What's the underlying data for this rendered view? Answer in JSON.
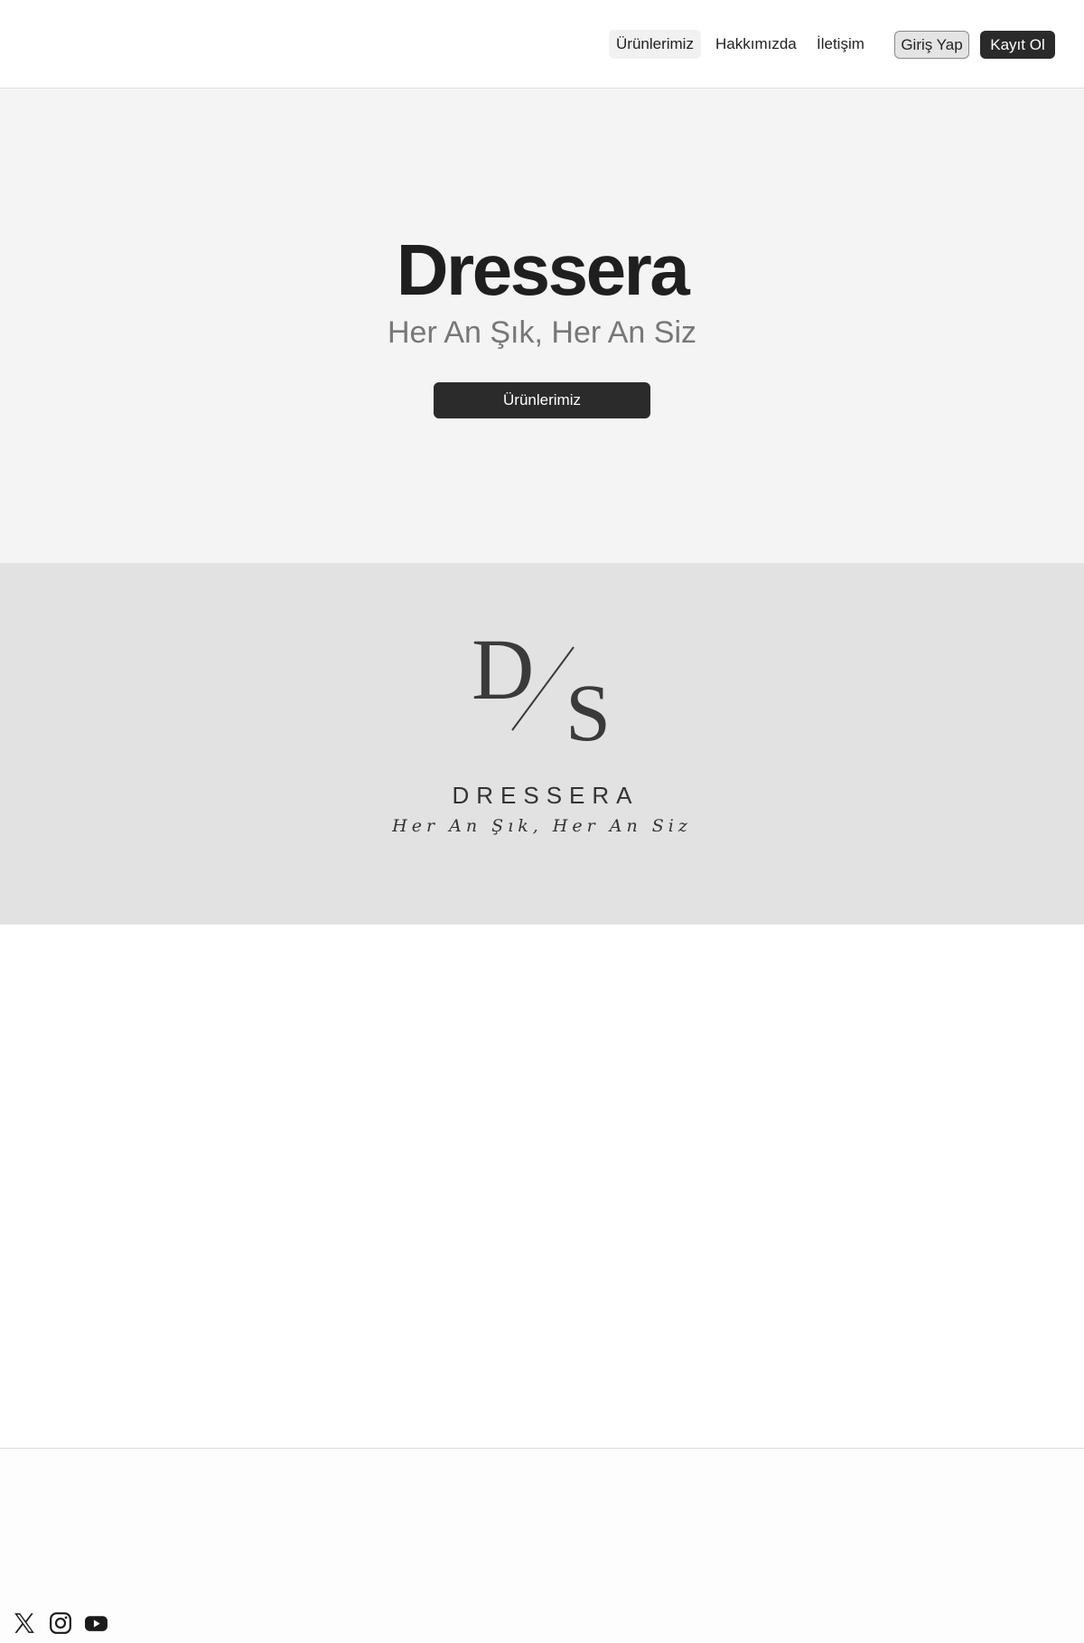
{
  "nav": {
    "links": [
      {
        "label": "Ürünlerimiz"
      },
      {
        "label": "Hakkımızda"
      },
      {
        "label": "İletişim"
      }
    ],
    "login_label": "Giriş Yap",
    "register_label": "Kayıt Ol"
  },
  "hero": {
    "title": "Dressera",
    "subtitle": "Her An Şık, Her An Siz",
    "cta_label": "Ürünlerimiz"
  },
  "brand": {
    "logo_letters": [
      "D",
      "S"
    ],
    "name": "DRESSERA",
    "tagline": "Her An Şık, Her An Siz"
  },
  "footer": {
    "social_icons": [
      "x-icon",
      "instagram-icon",
      "youtube-icon"
    ]
  },
  "colors": {
    "primary_dark": "#2b2b2b",
    "hero_bg": "#f4f4f4",
    "brand_band_bg": "#e2e2e2"
  }
}
